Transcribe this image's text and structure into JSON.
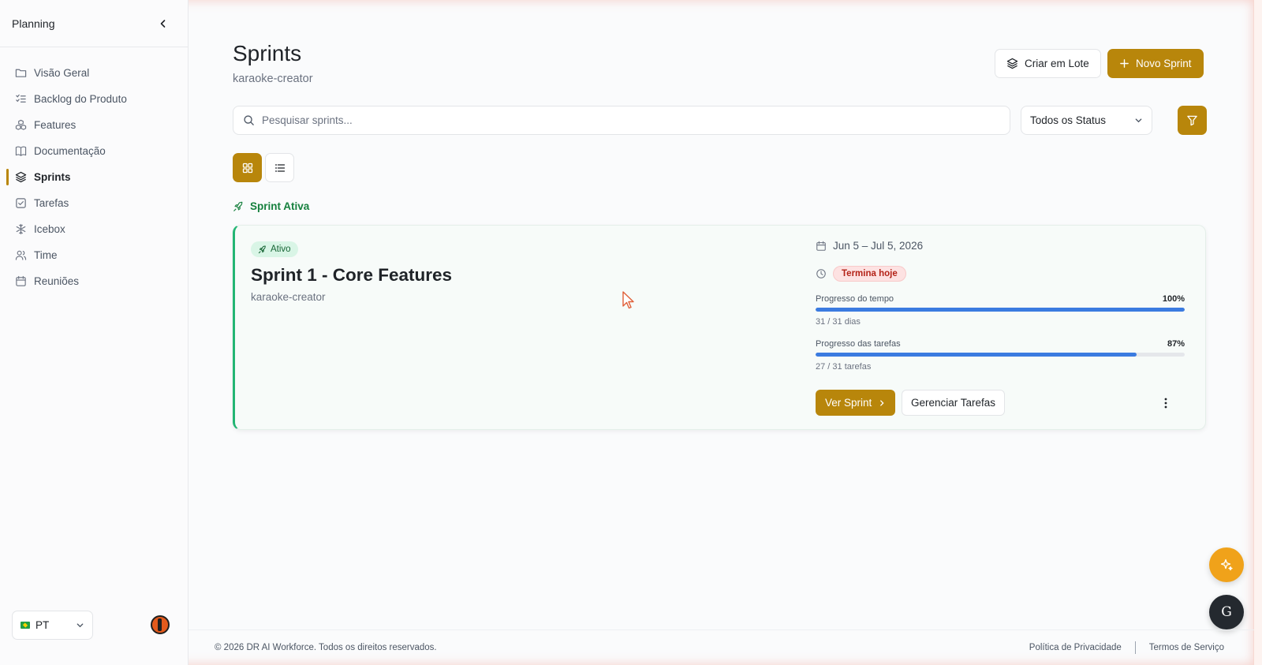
{
  "sidebar": {
    "title": "Planning",
    "items": [
      {
        "label": "Visão Geral",
        "icon": "folder-icon"
      },
      {
        "label": "Backlog do Produto",
        "icon": "list-checks-icon"
      },
      {
        "label": "Features",
        "icon": "boxes-icon"
      },
      {
        "label": "Documentação",
        "icon": "book-icon"
      },
      {
        "label": "Sprints",
        "icon": "layers-icon",
        "active": true
      },
      {
        "label": "Tarefas",
        "icon": "checkbox-icon"
      },
      {
        "label": "Icebox",
        "icon": "snowflake-icon"
      },
      {
        "label": "Time",
        "icon": "users-icon"
      },
      {
        "label": "Reuniões",
        "icon": "calendar-icon"
      }
    ],
    "language": "PT"
  },
  "header": {
    "title": "Sprints",
    "subtitle": "karaoke-creator",
    "batch_button": "Criar em Lote",
    "new_button": "Novo Sprint"
  },
  "search": {
    "placeholder": "Pesquisar sprints..."
  },
  "status_filter": {
    "selected": "Todos os Status"
  },
  "section": {
    "label": "Sprint Ativa"
  },
  "sprint": {
    "badge": "Ativo",
    "title": "Sprint 1 - Core Features",
    "project": "karaoke-creator",
    "dates": "Jun 5 – Jul 5, 2026",
    "ending_badge": "Termina hoje",
    "time_progress": {
      "label": "Progresso do tempo",
      "percent_label": "100%",
      "fraction": 1.0,
      "detail": "31 / 31 dias"
    },
    "task_progress": {
      "label": "Progresso das tarefas",
      "percent_label": "87%",
      "fraction": 0.87,
      "detail": "27 / 31 tarefas"
    },
    "view_button": "Ver Sprint",
    "manage_button": "Gerenciar Tarefas"
  },
  "footer": {
    "copyright": "© 2026 DR AI Workforce. Todos os direitos reservados.",
    "privacy": "Política de Privacidade",
    "terms": "Termos de Serviço"
  },
  "fab": {
    "g_label": "G"
  },
  "colors": {
    "accent": "#b8860b",
    "active_green": "#22b573",
    "progress_blue": "#3b7be0",
    "danger": "#b42318"
  }
}
